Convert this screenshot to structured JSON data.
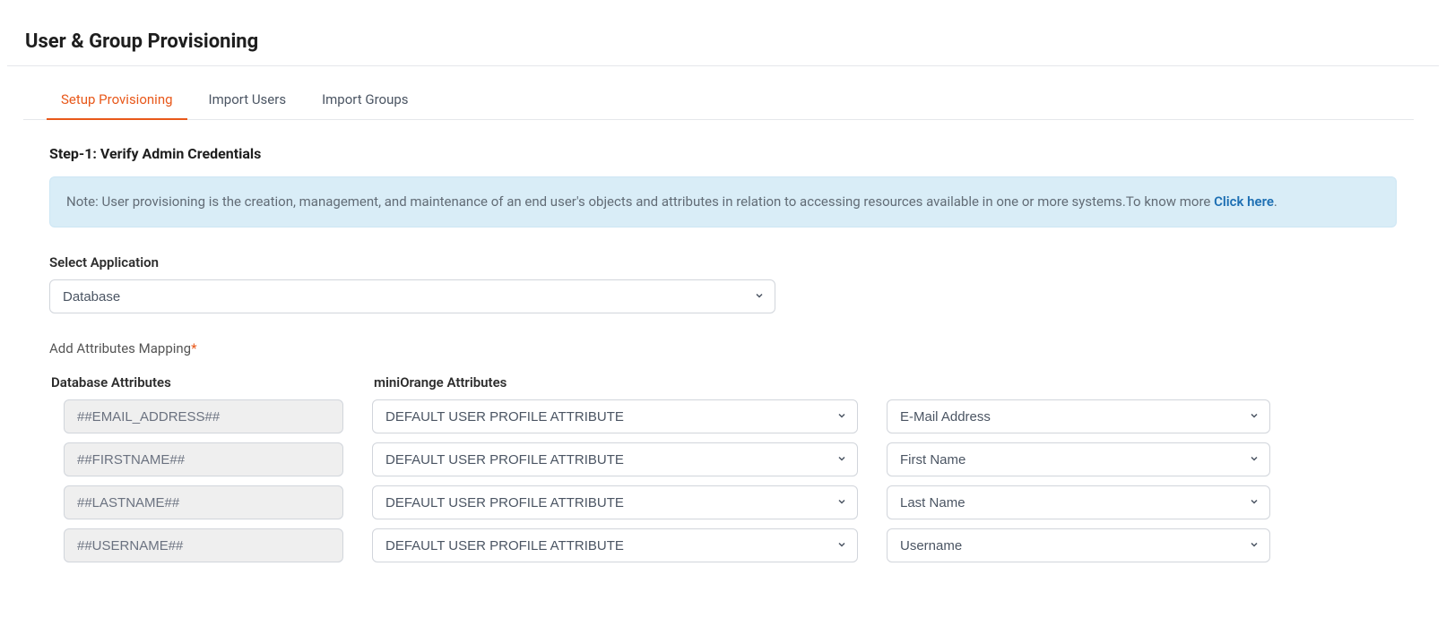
{
  "page_title": "User & Group Provisioning",
  "tabs": [
    {
      "label": "Setup Provisioning",
      "active": true
    },
    {
      "label": "Import Users",
      "active": false
    },
    {
      "label": "Import Groups",
      "active": false
    }
  ],
  "step_heading": "Step-1: Verify Admin Credentials",
  "note": {
    "prefix": "Note: User provisioning is the creation, management, and maintenance of an end user's objects and attributes in relation to accessing resources available in one or more systems.To know more ",
    "link_text": "Click here",
    "suffix": "."
  },
  "select_application": {
    "label": "Select Application",
    "value": "Database"
  },
  "attributes_mapping_label": "Add Attributes Mapping",
  "columns": {
    "db": "Database Attributes",
    "mo": "miniOrange Attributes"
  },
  "profile_attr_default": "DEFAULT USER PROFILE ATTRIBUTE",
  "rows": [
    {
      "db": "##EMAIL_ADDRESS##",
      "mo": "DEFAULT USER PROFILE ATTRIBUTE",
      "field": "E-Mail Address"
    },
    {
      "db": "##FIRSTNAME##",
      "mo": "DEFAULT USER PROFILE ATTRIBUTE",
      "field": "First Name"
    },
    {
      "db": "##LASTNAME##",
      "mo": "DEFAULT USER PROFILE ATTRIBUTE",
      "field": "Last Name"
    },
    {
      "db": "##USERNAME##",
      "mo": "DEFAULT USER PROFILE ATTRIBUTE",
      "field": "Username"
    }
  ]
}
